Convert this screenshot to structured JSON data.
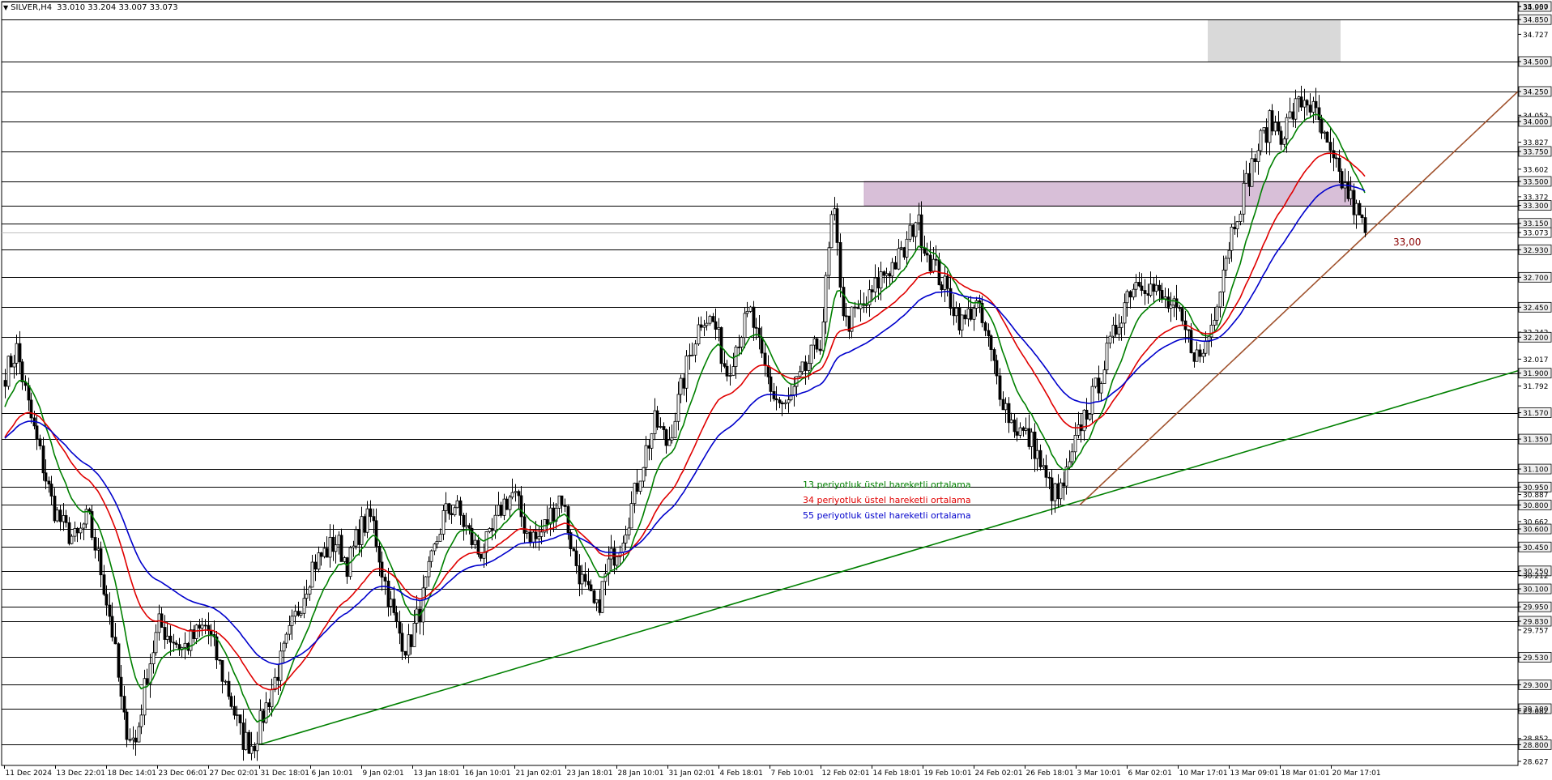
{
  "window": {
    "symbol": "SILVER,H4",
    "ohlc": [
      "33.010",
      "33.204",
      "33.007",
      "33.073"
    ]
  },
  "chart_data": {
    "type": "candlestick",
    "title": "",
    "price_range": [
      28.627,
      34.957
    ],
    "current_price": "33.073",
    "horizontal_levels": [
      35.0,
      34.85,
      34.5,
      34.25,
      34.0,
      33.75,
      33.5,
      33.3,
      33.15,
      33.073,
      32.93,
      32.7,
      32.45,
      32.2,
      31.9,
      31.57,
      31.35,
      31.1,
      30.95,
      30.8,
      30.6,
      30.45,
      30.25,
      30.1,
      29.95,
      29.83,
      29.53,
      29.3,
      29.1,
      28.8
    ],
    "y_axis_labels": [
      "35.000",
      "34.957",
      "34.850",
      "34.727",
      "34.500",
      "34.250",
      "34.052",
      "34.000",
      "33.827",
      "33.750",
      "33.602",
      "33.500",
      "33.372",
      "33.300",
      "33.150",
      "33.073",
      "32.930",
      "32.700",
      "32.450",
      "32.242",
      "32.200",
      "32.017",
      "31.900",
      "31.792",
      "31.570",
      "31.350",
      "31.100",
      "30.950",
      "30.887",
      "30.800",
      "30.662",
      "30.600",
      "30.450",
      "30.250",
      "30.212",
      "30.100",
      "29.950",
      "29.830",
      "29.757",
      "29.530",
      "29.300",
      "29.100",
      "29.082",
      "28.852",
      "28.800",
      "28.627"
    ],
    "x_axis_labels": [
      "11 Dec 2024",
      "13 Dec 22:01",
      "18 Dec 14:01",
      "23 Dec 06:01",
      "27 Dec 02:01",
      "31 Dec 18:01",
      "6 Jan 10:01",
      "9 Jan 02:01",
      "13 Jan 18:01",
      "16 Jan 10:01",
      "21 Jan 02:01",
      "23 Jan 18:01",
      "28 Jan 10:01",
      "31 Jan 02:01",
      "4 Feb 18:01",
      "7 Feb 10:01",
      "12 Feb 02:01",
      "14 Feb 18:01",
      "19 Feb 10:01",
      "24 Feb 02:01",
      "26 Feb 18:01",
      "3 Mar 10:01",
      "6 Mar 02:01",
      "10 Mar 17:01",
      "13 Mar 09:01",
      "18 Mar 01:01",
      "20 Mar 17:01"
    ],
    "price_path": [
      31.9,
      32.1,
      31.6,
      31.2,
      30.8,
      30.6,
      30.5,
      30.7,
      30.3,
      29.8,
      29.0,
      28.8,
      29.4,
      29.8,
      29.7,
      29.6,
      29.7,
      29.8,
      29.5,
      29.2,
      28.85,
      28.8,
      29.1,
      29.4,
      29.7,
      30.0,
      30.3,
      30.4,
      30.5,
      30.3,
      30.6,
      30.7,
      30.2,
      29.8,
      29.6,
      29.9,
      30.3,
      30.7,
      30.8,
      30.6,
      30.4,
      30.5,
      30.8,
      30.9,
      30.6,
      30.5,
      30.7,
      30.9,
      30.4,
      30.1,
      29.9,
      30.3,
      30.5,
      30.8,
      31.2,
      31.5,
      31.3,
      31.7,
      32.1,
      32.4,
      32.3,
      31.9,
      32.2,
      32.4,
      32.0,
      31.7,
      31.6,
      31.8,
      32.0,
      32.2,
      33.3,
      32.3,
      32.4,
      32.5,
      32.7,
      32.8,
      32.9,
      33.2,
      32.9,
      32.7,
      32.5,
      32.3,
      32.5,
      32.2,
      31.8,
      31.5,
      31.4,
      31.3,
      31.0,
      30.85,
      31.1,
      31.5,
      31.7,
      32.0,
      32.3,
      32.6,
      32.7,
      32.6,
      32.5,
      32.4,
      32.2,
      32.0,
      32.3,
      32.8,
      33.2,
      33.5,
      33.8,
      34.0,
      33.9,
      34.1,
      34.2,
      34.0,
      33.7,
      33.5,
      33.3,
      33.073
    ],
    "ema_series": [
      {
        "name": "13 periyotluk üstel hareketli ortalama",
        "color": "#008000",
        "period": 13
      },
      {
        "name": "34 periyotluk üstel hareketli ortalama",
        "color": "#e00000",
        "period": 34
      },
      {
        "name": "55 periyotluk üstel hareketli ortalama",
        "color": "#0000cc",
        "period": 55
      }
    ],
    "annotations": {
      "trendline_label": "33,00",
      "resistance_zone": {
        "low": 33.3,
        "high": 33.5,
        "color": "#d8bfd8"
      },
      "gray_zone": {
        "low": 34.5,
        "high": 34.85,
        "color": "#d9d9d9"
      },
      "trendline_green": {
        "color": "#008000",
        "from_price": 28.8,
        "to_price": 31.92
      },
      "trendline_brown": {
        "color": "#a0522d",
        "from_price": 30.8,
        "to_price": 34.25
      }
    }
  }
}
